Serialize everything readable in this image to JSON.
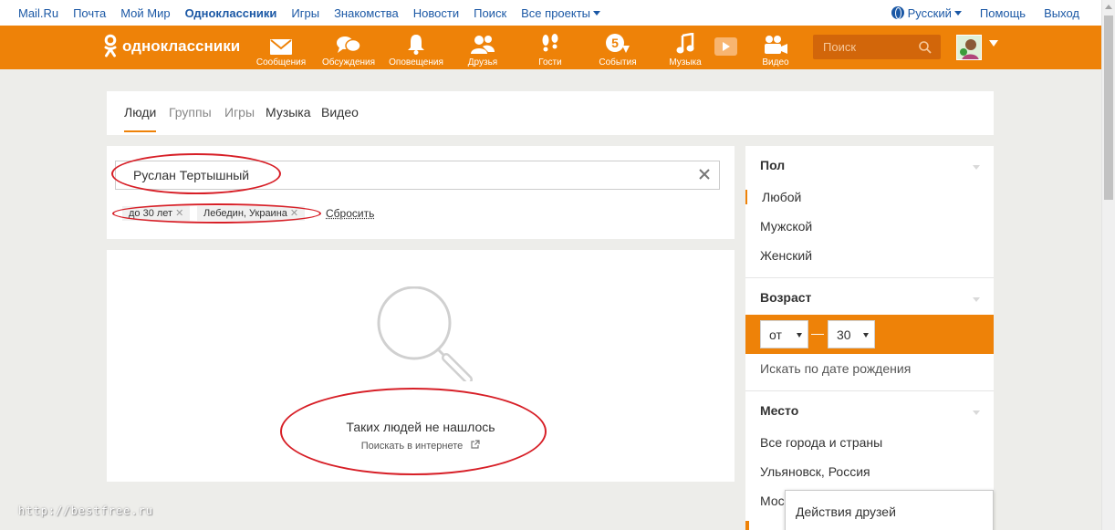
{
  "portal": {
    "links": [
      "Mail.Ru",
      "Почта",
      "Мой Мир",
      "Одноклассники",
      "Игры",
      "Знакомства",
      "Новости",
      "Поиск",
      "Все проекты"
    ],
    "language": "Русский",
    "help": "Помощь",
    "logout": "Выход"
  },
  "header": {
    "logo": "одноклассники",
    "nav": [
      {
        "label": "Сообщения",
        "icon": "envelope-icon"
      },
      {
        "label": "Обсуждения",
        "icon": "chat-bubbles-icon"
      },
      {
        "label": "Оповещения",
        "icon": "bell-icon"
      },
      {
        "label": "Друзья",
        "icon": "friends-icon"
      },
      {
        "label": "Гости",
        "icon": "footprints-icon"
      },
      {
        "label": "События",
        "icon": "events-icon",
        "badge": "5"
      },
      {
        "label": "Музыка",
        "icon": "music-note-icon"
      },
      {
        "label": "Видео",
        "icon": "video-camera-icon"
      }
    ],
    "search_placeholder": "Поиск",
    "accent": "#ee8208"
  },
  "tabs": [
    {
      "label": "Люди",
      "active": true
    },
    {
      "label": "Группы"
    },
    {
      "label": "Игры"
    },
    {
      "label": "Музыка"
    },
    {
      "label": "Видео"
    }
  ],
  "search": {
    "query": "Руслан Тертышный",
    "chips": [
      "до 30 лет",
      "Лебедин, Украина"
    ],
    "reset": "Сбросить"
  },
  "results": {
    "empty_title": "Таких людей не нашлось",
    "search_web": "Поискать в интернете"
  },
  "filters": {
    "gender": {
      "title": "Пол",
      "options": [
        "Любой",
        "Мужской",
        "Женский"
      ]
    },
    "age": {
      "title": "Возраст",
      "from": "от",
      "to": "30",
      "birthdate": "Искать по дате рождения"
    },
    "place": {
      "title": "Место",
      "options": [
        "Все города и страны",
        "Ульяновск, Россия",
        "Мос"
      ]
    }
  },
  "popup": "Действия друзей",
  "watermark": "http://bestfree.ru"
}
